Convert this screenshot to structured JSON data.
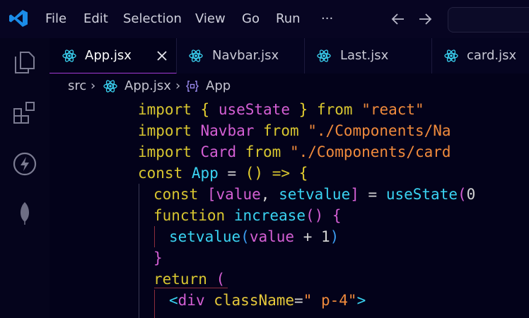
{
  "menu": [
    "File",
    "Edit",
    "Selection",
    "View",
    "Go",
    "Run",
    "···"
  ],
  "tabs": [
    {
      "label": "App.jsx",
      "active": true
    },
    {
      "label": "Navbar.jsx",
      "active": false
    },
    {
      "label": "Last.jsx",
      "active": false
    },
    {
      "label": "card.jsx",
      "active": false
    }
  ],
  "breadcrumb": {
    "folder": "src",
    "file": "App.jsx",
    "symbol": "App"
  },
  "activity_icons": [
    "explorer-icon",
    "extensions-icon",
    "lightning-icon",
    "mongodb-leaf-icon"
  ],
  "code": {
    "line1": [
      "import",
      "{",
      "useState",
      "}",
      "from",
      "\"react\""
    ],
    "line2": [
      "import",
      "Navbar",
      "from",
      "\"./Components/Na"
    ],
    "line3": [
      "import",
      "Card",
      "from",
      "\"./Components/card"
    ],
    "line4": [
      "const",
      "App",
      "=",
      "()",
      "=>",
      "{"
    ],
    "line5": [
      "const",
      "[",
      "value",
      ",",
      "setvalue",
      "]",
      "=",
      "useState",
      "(",
      "0"
    ],
    "line6": [
      "function",
      "increase",
      "()",
      "{"
    ],
    "line7": [
      "setvalue",
      "(",
      "value",
      "+",
      "1",
      ")"
    ],
    "line8": [
      "}"
    ],
    "line9": [
      "return",
      "("
    ],
    "line10": [
      "<",
      "div",
      "className",
      "=",
      "\" p-4\"",
      ">"
    ]
  },
  "colors": {
    "background": "#03021a",
    "keyword": "#d8c630",
    "function": "#3ad3f2",
    "string": "#f08a3c",
    "identifier": "#d45fd4",
    "accent": "#a23bd6"
  }
}
